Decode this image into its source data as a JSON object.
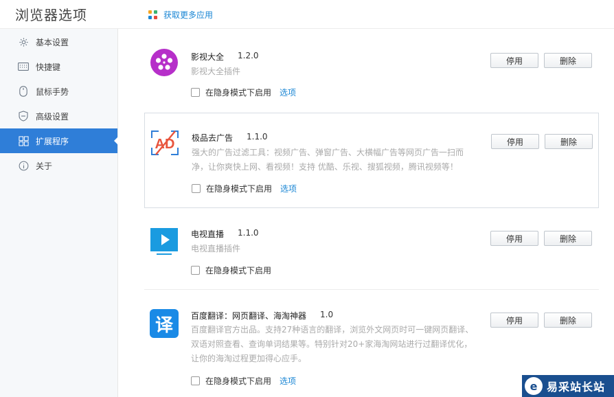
{
  "header": {
    "title": "浏览器选项",
    "get_more": "获取更多应用"
  },
  "sidebar": {
    "items": [
      {
        "label": "基本设置",
        "icon": "gear-icon"
      },
      {
        "label": "快捷键",
        "icon": "keyboard-icon"
      },
      {
        "label": "鼠标手势",
        "icon": "mouse-icon"
      },
      {
        "label": "高级设置",
        "icon": "shield-icon"
      },
      {
        "label": "扩展程序",
        "icon": "extensions-icon",
        "active": true
      },
      {
        "label": "关于",
        "icon": "info-icon"
      }
    ]
  },
  "extensions": [
    {
      "name": "影视大全",
      "version": "1.2.0",
      "desc": "影视大全插件",
      "incognito_label": "在隐身模式下启用",
      "options_label": "选项",
      "disable_label": "停用",
      "delete_label": "删除"
    },
    {
      "name": "极品去广告",
      "version": "1.1.0",
      "desc": "强大的广告过滤工具：视频广告、弹窗广告、大横幅广告等网页广告一扫而净，让你爽快上网、看视频！支持 优酷、乐视、搜狐视频，腾讯视频等！",
      "incognito_label": "在隐身模式下启用",
      "options_label": "选项",
      "disable_label": "停用",
      "delete_label": "删除"
    },
    {
      "name": "电视直播",
      "version": "1.1.0",
      "desc": "电视直播插件",
      "incognito_label": "在隐身模式下启用",
      "disable_label": "停用",
      "delete_label": "删除"
    },
    {
      "name": "百度翻译：网页翻译、海淘神器",
      "version": "1.0",
      "desc": "百度翻译官方出品。支持27种语言的翻译，浏览外文网页时可一键网页翻译、双语对照查看、查询单词结果等。特别针对20+家海淘网站进行过翻译优化，让你的海淘过程更加得心应手。",
      "incognito_label": "在隐身模式下启用",
      "options_label": "选项",
      "disable_label": "停用",
      "delete_label": "删除",
      "icon_char": "译"
    }
  ],
  "watermark": {
    "text": "易采站长站"
  },
  "colors": {
    "accent": "#2f7ed8",
    "link": "#1a86d4"
  }
}
